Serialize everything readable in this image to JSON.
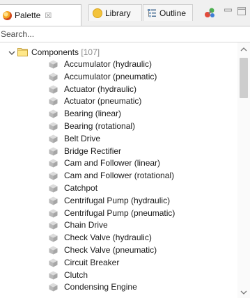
{
  "tabs": {
    "palette": {
      "label": "Palette",
      "close": "☒",
      "icon": "palette-icon"
    },
    "library": {
      "label": "Library",
      "icon": "library-icon"
    },
    "outline": {
      "label": "Outline",
      "icon": "outline-icon"
    }
  },
  "toolbar": {
    "icons": [
      "link-with-editor-icon",
      "minimize-icon",
      "maximize-icon"
    ]
  },
  "search": {
    "placeholder": "Search..."
  },
  "tree": {
    "root": {
      "label": "Components",
      "count": "[107]",
      "expanded": true,
      "icon": "folder-icon"
    },
    "items": [
      "Accumulator (hydraulic)",
      "Accumulator (pneumatic)",
      "Actuator (hydraulic)",
      "Actuator (pneumatic)",
      "Bearing (linear)",
      "Bearing (rotational)",
      "Belt Drive",
      "Bridge Rectifier",
      "Cam and Follower (linear)",
      "Cam and Follower (rotational)",
      "Catchpot",
      "Centrifugal Pump (hydraulic)",
      "Centrifugal Pump (pneumatic)",
      "Chain Drive",
      "Check Valve (hydraulic)",
      "Check Valve (pneumatic)",
      "Circuit Breaker",
      "Clutch",
      "Condensing Engine"
    ],
    "item_icon": "component-cube-icon"
  },
  "colors": {
    "tab_border": "#c6c6c6",
    "count_gray": "#8a8a8a",
    "cube_gray": "#bdbdbd"
  }
}
